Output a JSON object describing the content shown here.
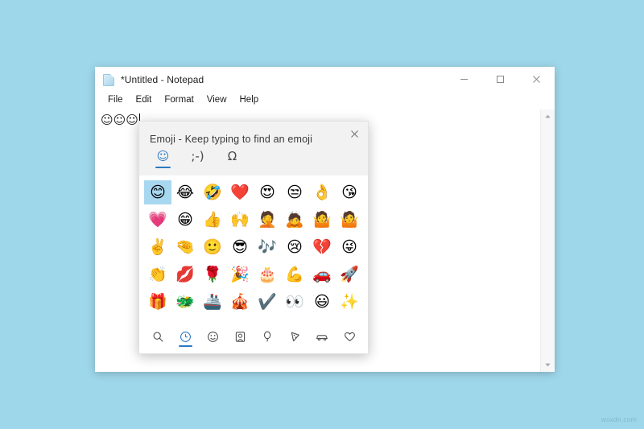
{
  "desktop": {
    "background_color": "#9ed7ea",
    "watermark": "wsxdn.com"
  },
  "notepad": {
    "title": "*Untitled - Notepad",
    "title_icon": "notepad-document-icon",
    "window_controls": [
      {
        "name": "minimize",
        "glyph": "–"
      },
      {
        "name": "maximize",
        "glyph": "□"
      },
      {
        "name": "close",
        "glyph": "✕"
      }
    ],
    "menu": [
      "File",
      "Edit",
      "Format",
      "View",
      "Help"
    ],
    "text_content": "☺☺☺",
    "scrollbar": {
      "up_arrow": "▲",
      "down_arrow": "▼"
    }
  },
  "emoji_panel": {
    "title": "Emoji - Keep typing to find an emoji",
    "close_label": "✕",
    "accent_color": "#2b79c2",
    "selection_color": "#a8d8f0",
    "tabs": [
      {
        "name": "tab-emoji",
        "glyph": "☺",
        "active": true
      },
      {
        "name": "tab-kaomoji",
        "glyph": ";-)",
        "active": false
      },
      {
        "name": "tab-symbols",
        "glyph": "Ω",
        "active": false
      }
    ],
    "grid": [
      [
        {
          "glyph": "😊",
          "name": "smiling-face-smiling-eyes-emoji",
          "selected": true
        },
        {
          "glyph": "😂",
          "name": "face-with-tears-of-joy-emoji",
          "selected": false
        },
        {
          "glyph": "🤣",
          "name": "rolling-on-the-floor-laughing-emoji",
          "selected": false
        },
        {
          "glyph": "❤️",
          "name": "red-heart-emoji",
          "selected": false
        },
        {
          "glyph": "😍",
          "name": "smiling-face-with-heart-eyes-emoji",
          "selected": false
        },
        {
          "glyph": "😒",
          "name": "unamused-face-emoji",
          "selected": false
        },
        {
          "glyph": "👌",
          "name": "ok-hand-emoji",
          "selected": false
        },
        {
          "glyph": "😘",
          "name": "face-blowing-a-kiss-emoji",
          "selected": false
        }
      ],
      [
        {
          "glyph": "💗",
          "name": "growing-heart-emoji",
          "selected": false
        },
        {
          "glyph": "😁",
          "name": "beaming-face-emoji",
          "selected": false
        },
        {
          "glyph": "👍",
          "name": "thumbs-up-emoji",
          "selected": false
        },
        {
          "glyph": "🙌",
          "name": "raising-hands-emoji",
          "selected": false
        },
        {
          "glyph": "🤦",
          "name": "person-facepalming-emoji",
          "selected": false
        },
        {
          "glyph": "🙇",
          "name": "person-bowing-emoji",
          "selected": false
        },
        {
          "glyph": "🤷",
          "name": "person-shrugging-emoji",
          "selected": false
        },
        {
          "glyph": "🤷",
          "name": "person-shrugging-alt-emoji",
          "selected": false
        }
      ],
      [
        {
          "glyph": "✌️",
          "name": "victory-hand-emoji",
          "selected": false
        },
        {
          "glyph": "🤏",
          "name": "pinching-hand-emoji",
          "selected": false
        },
        {
          "glyph": "🙂",
          "name": "slightly-smiling-face-emoji",
          "selected": false
        },
        {
          "glyph": "😎",
          "name": "smiling-face-with-sunglasses-emoji",
          "selected": false
        },
        {
          "glyph": "🎶",
          "name": "musical-notes-emoji",
          "selected": false
        },
        {
          "glyph": "😢",
          "name": "crying-face-emoji",
          "selected": false
        },
        {
          "glyph": "💔",
          "name": "broken-heart-emoji",
          "selected": false
        },
        {
          "glyph": "😜",
          "name": "winking-face-with-tongue-emoji",
          "selected": false
        }
      ],
      [
        {
          "glyph": "👏",
          "name": "clapping-hands-emoji",
          "selected": false
        },
        {
          "glyph": "💋",
          "name": "kiss-mark-emoji",
          "selected": false
        },
        {
          "glyph": "🌹",
          "name": "rose-emoji",
          "selected": false
        },
        {
          "glyph": "🎉",
          "name": "party-popper-emoji",
          "selected": false
        },
        {
          "glyph": "🎂",
          "name": "birthday-cake-emoji",
          "selected": false
        },
        {
          "glyph": "💪",
          "name": "flexed-biceps-emoji",
          "selected": false
        },
        {
          "glyph": "🚗",
          "name": "automobile-emoji",
          "selected": false
        },
        {
          "glyph": "🚀",
          "name": "rocket-emoji",
          "selected": false
        }
      ],
      [
        {
          "glyph": "🎁",
          "name": "wrapped-gift-emoji",
          "selected": false
        },
        {
          "glyph": "🐲",
          "name": "dragon-face-emoji",
          "selected": false
        },
        {
          "glyph": "🚢",
          "name": "ship-emoji",
          "selected": false
        },
        {
          "glyph": "🎪",
          "name": "circus-tent-emoji",
          "selected": false
        },
        {
          "glyph": "✔️",
          "name": "check-mark-emoji",
          "selected": false
        },
        {
          "glyph": "👀",
          "name": "eyes-emoji",
          "selected": false
        },
        {
          "glyph": "😃",
          "name": "grinning-face-big-eyes-emoji",
          "selected": false
        },
        {
          "glyph": "✨",
          "name": "sparkles-emoji",
          "selected": false
        }
      ]
    ],
    "categories": [
      {
        "name": "search-icon",
        "label": "Search",
        "active": false
      },
      {
        "name": "clock-icon",
        "label": "Recently used",
        "active": true
      },
      {
        "name": "smiley-icon",
        "label": "Smileys and animals",
        "active": false
      },
      {
        "name": "people-icon",
        "label": "People",
        "active": false
      },
      {
        "name": "balloon-icon",
        "label": "Celebration and objects",
        "active": false
      },
      {
        "name": "food-icon",
        "label": "Food and plants",
        "active": false
      },
      {
        "name": "car-icon",
        "label": "Transport and places",
        "active": false
      },
      {
        "name": "heart-icon",
        "label": "Symbols",
        "active": false
      }
    ]
  }
}
